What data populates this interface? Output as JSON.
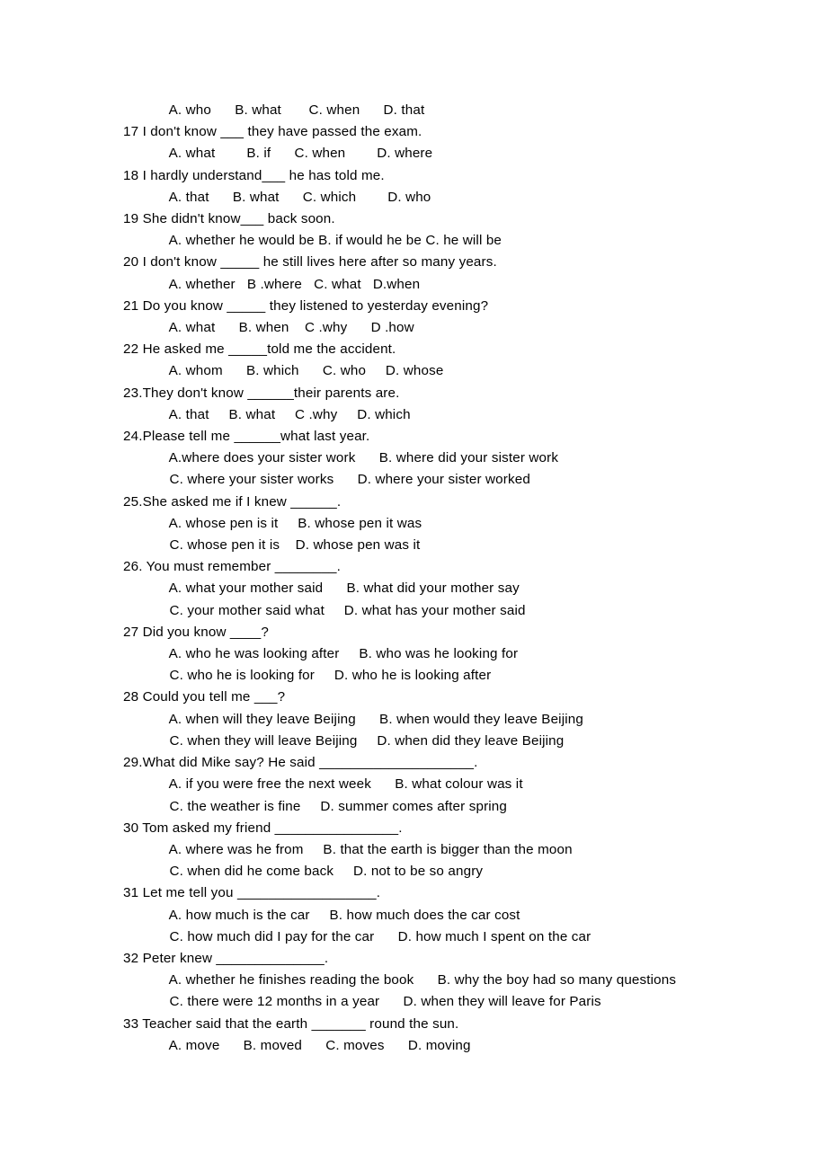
{
  "document": {
    "type": "grammar-worksheet",
    "subject": "English noun clauses / reported speech multiple choice",
    "page_background": "#ffffff",
    "text_color": "#010101",
    "lines": [
      {
        "kind": "options",
        "text": "    A. who      B. what       C. when      D. that"
      },
      {
        "kind": "question",
        "text": "17 I don't know ___ they have passed the exam."
      },
      {
        "kind": "options",
        "text": "    A. what        B. if      C. when        D. where"
      },
      {
        "kind": "question",
        "text": "18 I hardly understand___ he has told me."
      },
      {
        "kind": "options",
        "text": "    A. that      B. what      C. which        D. who"
      },
      {
        "kind": "question",
        "text": "19 She didn't know___ back soon."
      },
      {
        "kind": "options",
        "text": "    A. whether he would be B. if would he be C. he will be"
      },
      {
        "kind": "question",
        "text": "20 I don't know _____ he still lives here after so many years."
      },
      {
        "kind": "options",
        "text": "    A. whether   B .where   C. what   D.when"
      },
      {
        "kind": "question",
        "text": "21 Do you know _____ they listened to yesterday evening?"
      },
      {
        "kind": "options",
        "text": "    A. what      B. when    C .why      D .how"
      },
      {
        "kind": "question",
        "text": "22 He asked me _____told me the accident."
      },
      {
        "kind": "options",
        "text": "    A. whom      B. which      C. who     D. whose"
      },
      {
        "kind": "question",
        "text": "23.They don't know ______their parents are."
      },
      {
        "kind": "options",
        "text": "    A. that     B. what     C .why     D. which"
      },
      {
        "kind": "question",
        "text": "24.Please tell me ______what last year."
      },
      {
        "kind": "options",
        "text": "    A.where does your sister work      B. where did your sister work"
      },
      {
        "kind": "options",
        "text": "    C. where your sister works      D. where your sister worked"
      },
      {
        "kind": "question",
        "text": "25.She asked me if I knew ______."
      },
      {
        "kind": "options",
        "text": "    A. whose pen is it     B. whose pen it was"
      },
      {
        "kind": "options",
        "text": "    C. whose pen it is    D. whose pen was it"
      },
      {
        "kind": "question",
        "text": "26. You must remember ________."
      },
      {
        "kind": "options",
        "text": "    A. what your mother said      B. what did your mother say"
      },
      {
        "kind": "options",
        "text": "    C. your mother said what     D. what has your mother said"
      },
      {
        "kind": "question",
        "text": "27 Did you know ____?"
      },
      {
        "kind": "options",
        "text": "    A. who he was looking after     B. who was he looking for"
      },
      {
        "kind": "options",
        "text": "    C. who he is looking for     D. who he is looking after"
      },
      {
        "kind": "question",
        "text": "28 Could you tell me ___?"
      },
      {
        "kind": "options",
        "text": "    A. when will they leave Beijing      B. when would they leave Beijing"
      },
      {
        "kind": "options",
        "text": "    C. when they will leave Beijing     D. when did they leave Beijing"
      },
      {
        "kind": "question",
        "text": "29.What did Mike say? He said ____________________."
      },
      {
        "kind": "options",
        "text": "    A. if you were free the next week      B. what colour was it"
      },
      {
        "kind": "options",
        "text": "    C. the weather is fine     D. summer comes after spring"
      },
      {
        "kind": "question",
        "text": "30 Tom asked my friend ________________."
      },
      {
        "kind": "options",
        "text": "    A. where was he from     B. that the earth is bigger than the moon"
      },
      {
        "kind": "options",
        "text": "    C. when did he come back     D. not to be so angry"
      },
      {
        "kind": "question",
        "text": "31 Let me tell you __________________."
      },
      {
        "kind": "options",
        "text": "    A. how much is the car     B. how much does the car cost"
      },
      {
        "kind": "options",
        "text": "    C. how much did I pay for the car      D. how much I spent on the car"
      },
      {
        "kind": "question",
        "text": "32 Peter knew ______________."
      },
      {
        "kind": "options",
        "text": "    A. whether he finishes reading the book      B. why the boy had so many questions"
      },
      {
        "kind": "options",
        "text": "    C. there were 12 months in a year      D. when they will leave for Paris"
      },
      {
        "kind": "question",
        "text": "33 Teacher said that the earth _______ round the sun."
      },
      {
        "kind": "options",
        "text": "    A. move      B. moved      C. moves      D. moving"
      }
    ]
  }
}
